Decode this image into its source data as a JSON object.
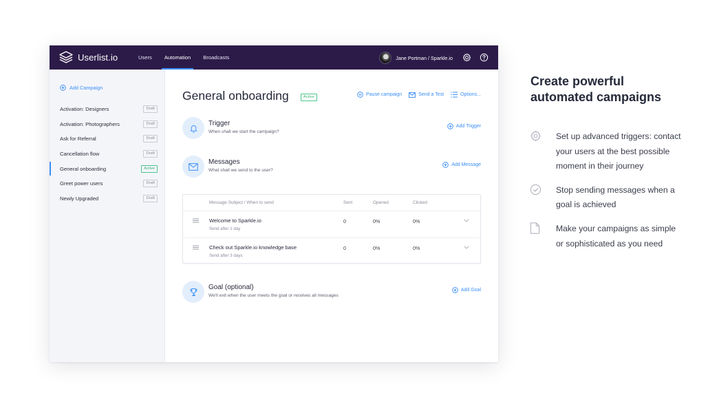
{
  "app": {
    "brand": "Userlist.io",
    "nav": [
      {
        "label": "Users",
        "active": false
      },
      {
        "label": "Automation",
        "active": true
      },
      {
        "label": "Broadcasts",
        "active": false
      }
    ],
    "user_label": "Jane Portman / Sparkle.io"
  },
  "sidebar": {
    "add_campaign": "Add Campaign",
    "items": [
      {
        "name": "Activation: Designers",
        "status": "Draft"
      },
      {
        "name": "Activation: Photographers",
        "status": "Draft"
      },
      {
        "name": "Ask for Referral",
        "status": "Draft"
      },
      {
        "name": "Cancellation flow",
        "status": "Draft"
      },
      {
        "name": "General onboarding",
        "status": "Active"
      },
      {
        "name": "Greet power users",
        "status": "Draft"
      },
      {
        "name": "Newly Upgraded",
        "status": "Draft"
      }
    ]
  },
  "main": {
    "title": "General onboarding",
    "status": "Active",
    "actions": {
      "pause": "Pause campaign",
      "test": "Send a Test",
      "options": "Options..."
    },
    "trigger": {
      "title": "Trigger",
      "desc": "When shall we start the campaign?",
      "add": "Add Trigger"
    },
    "messages": {
      "title": "Messages",
      "desc": "What shall we send to the user?",
      "add": "Add Message"
    },
    "table": {
      "headers": {
        "subject": "Message Subject / When to send",
        "sent": "Sent",
        "opened": "Opened",
        "clicked": "Clicked"
      },
      "rows": [
        {
          "subject": "Welcome to Sparkle.io",
          "when": "Send after 1 day",
          "sent": "0",
          "opened": "0%",
          "clicked": "0%"
        },
        {
          "subject": "Check out Sparkle.io knowledge base",
          "when": "Send after 3 days",
          "sent": "0",
          "opened": "0%",
          "clicked": "0%"
        }
      ]
    },
    "goal": {
      "title": "Goal (optional)",
      "desc": "We'll exit when the user meets the goal or receives all messages",
      "add": "Add Goal"
    }
  },
  "promo": {
    "title": "Create powerful automated campaigns",
    "features": [
      {
        "icon": "gear-icon",
        "text": "Set up advanced triggers: contact your users at the best possible moment in their journey"
      },
      {
        "icon": "check-circle-icon",
        "text": "Stop sending messages when a goal is achieved"
      },
      {
        "icon": "document-icon",
        "text": "Make your campaigns as simple or sophisticated as you need"
      }
    ]
  },
  "colors": {
    "topbar": "#2c1b49",
    "accent": "#3b8ef5",
    "active_badge": "#3bb47b",
    "sidebar_bg": "#f4f5f9"
  }
}
